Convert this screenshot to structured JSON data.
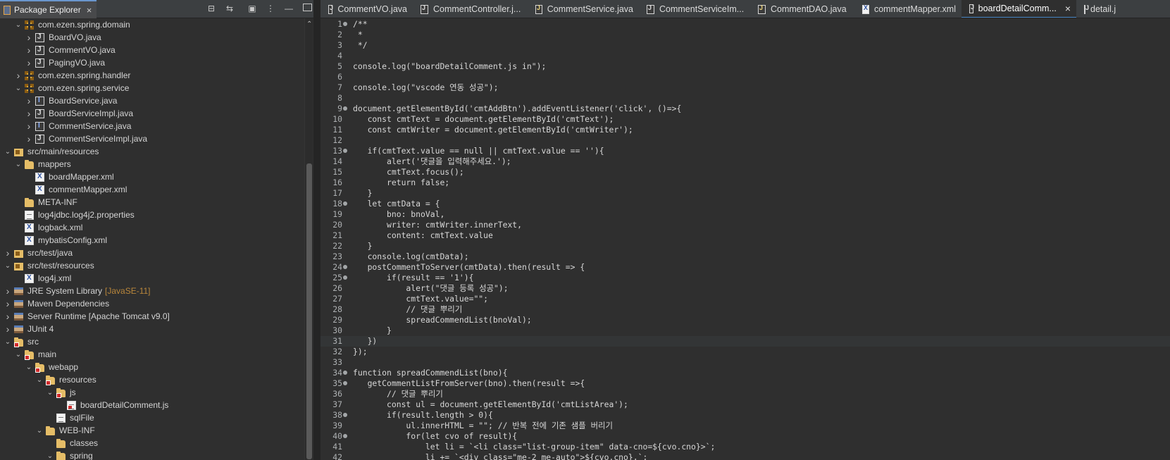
{
  "explorer": {
    "title": "Package Explorer",
    "close": "×",
    "tools": [
      "collapse-all-icon",
      "link-editor-icon",
      "focus-icon",
      "view-menu-icon",
      "minimize-icon",
      "maximize-icon"
    ],
    "rows": [
      {
        "label": "com.ezen.spring.domain",
        "depth": 2,
        "arrow": "v",
        "icon": "package"
      },
      {
        "label": "BoardVO.java",
        "depth": 3,
        "arrow": ">",
        "icon": "java"
      },
      {
        "label": "CommentVO.java",
        "depth": 3,
        "arrow": ">",
        "icon": "java"
      },
      {
        "label": "PagingVO.java",
        "depth": 3,
        "arrow": ">",
        "icon": "java"
      },
      {
        "label": "com.ezen.spring.handler",
        "depth": 2,
        "arrow": ">",
        "icon": "package"
      },
      {
        "label": "com.ezen.spring.service",
        "depth": 2,
        "arrow": "v",
        "icon": "package"
      },
      {
        "label": "BoardService.java",
        "depth": 3,
        "arrow": ">",
        "icon": "ijava"
      },
      {
        "label": "BoardServiceImpl.java",
        "depth": 3,
        "arrow": ">",
        "icon": "java"
      },
      {
        "label": "CommentService.java",
        "depth": 3,
        "arrow": ">",
        "icon": "ijava"
      },
      {
        "label": "CommentServiceImpl.java",
        "depth": 3,
        "arrow": ">",
        "icon": "java"
      },
      {
        "label": "src/main/resources",
        "depth": 1,
        "arrow": "v",
        "icon": "srcfolder"
      },
      {
        "label": "mappers",
        "depth": 2,
        "arrow": "v",
        "icon": "folder"
      },
      {
        "label": "boardMapper.xml",
        "depth": 3,
        "arrow": "",
        "icon": "xml"
      },
      {
        "label": "commentMapper.xml",
        "depth": 3,
        "arrow": "",
        "icon": "xml"
      },
      {
        "label": "META-INF",
        "depth": 2,
        "arrow": "",
        "icon": "folder"
      },
      {
        "label": "log4jdbc.log4j2.properties",
        "depth": 2,
        "arrow": "",
        "icon": "file"
      },
      {
        "label": "logback.xml",
        "depth": 2,
        "arrow": "",
        "icon": "xml"
      },
      {
        "label": "mybatisConfig.xml",
        "depth": 2,
        "arrow": "",
        "icon": "xml"
      },
      {
        "label": "src/test/java",
        "depth": 1,
        "arrow": ">",
        "icon": "srcfolder"
      },
      {
        "label": "src/test/resources",
        "depth": 1,
        "arrow": "v",
        "icon": "srcfolder"
      },
      {
        "label": "log4j.xml",
        "depth": 2,
        "arrow": "",
        "icon": "xml"
      },
      {
        "label": "JRE System Library",
        "extra": "[JavaSE-11]",
        "depth": 1,
        "arrow": ">",
        "icon": "lib"
      },
      {
        "label": "Maven Dependencies",
        "depth": 1,
        "arrow": ">",
        "icon": "lib"
      },
      {
        "label": "Server Runtime [Apache Tomcat v9.0]",
        "depth": 1,
        "arrow": ">",
        "icon": "lib"
      },
      {
        "label": "JUnit 4",
        "depth": 1,
        "arrow": ">",
        "icon": "lib"
      },
      {
        "label": "src",
        "depth": 1,
        "arrow": "v",
        "icon": "folder",
        "error": true
      },
      {
        "label": "main",
        "depth": 2,
        "arrow": "v",
        "icon": "folder",
        "error": true
      },
      {
        "label": "webapp",
        "depth": 3,
        "arrow": "v",
        "icon": "folder",
        "error": true
      },
      {
        "label": "resources",
        "depth": 4,
        "arrow": "v",
        "icon": "folder",
        "error": true
      },
      {
        "label": "js",
        "depth": 5,
        "arrow": "v",
        "icon": "folder",
        "error": true
      },
      {
        "label": "boardDetailComment.js",
        "depth": 6,
        "arrow": "",
        "icon": "file",
        "error": true
      },
      {
        "label": "sqlFile",
        "depth": 5,
        "arrow": "",
        "icon": "file"
      },
      {
        "label": "WEB-INF",
        "depth": 4,
        "arrow": "v",
        "icon": "folder"
      },
      {
        "label": "classes",
        "depth": 5,
        "arrow": "",
        "icon": "folder"
      },
      {
        "label": "spring",
        "depth": 5,
        "arrow": "v",
        "icon": "folder"
      }
    ]
  },
  "editor": {
    "tabs": [
      {
        "label": "CommentVO.java",
        "icon": "j"
      },
      {
        "label": "CommentController.j...",
        "icon": "j"
      },
      {
        "label": "CommentService.java",
        "icon": "s"
      },
      {
        "label": "CommentServiceIm...",
        "icon": "j"
      },
      {
        "label": "CommentDAO.java",
        "icon": "s"
      },
      {
        "label": "commentMapper.xml",
        "icon": "x"
      },
      {
        "label": "boardDetailComm...",
        "icon": "j",
        "active": true
      },
      {
        "label": "detail.j",
        "icon": "j"
      }
    ],
    "current_line": 31,
    "lines": [
      {
        "n": "1",
        "t": "/**",
        "fold": true
      },
      {
        "n": "2",
        "t": " *"
      },
      {
        "n": "3",
        "t": " */"
      },
      {
        "n": "4",
        "t": ""
      },
      {
        "n": "5",
        "t": "console.log(\"boardDetailComment.js in\");"
      },
      {
        "n": "6",
        "t": ""
      },
      {
        "n": "7",
        "t": "console.log(\"vscode 연동 성공\");"
      },
      {
        "n": "8",
        "t": ""
      },
      {
        "n": "9",
        "t": "document.getElementById('cmtAddBtn').addEventListener('click', ()=>{",
        "fold": true
      },
      {
        "n": "10",
        "t": "   const cmtText = document.getElementById('cmtText');"
      },
      {
        "n": "11",
        "t": "   const cmtWriter = document.getElementById('cmtWriter');"
      },
      {
        "n": "12",
        "t": ""
      },
      {
        "n": "13",
        "t": "   if(cmtText.value == null || cmtText.value == ''){",
        "fold": true
      },
      {
        "n": "14",
        "t": "       alert('댓글을 입력해주세요.');"
      },
      {
        "n": "15",
        "t": "       cmtText.focus();"
      },
      {
        "n": "16",
        "t": "       return false;"
      },
      {
        "n": "17",
        "t": "   }"
      },
      {
        "n": "18",
        "t": "   let cmtData = {",
        "fold": true
      },
      {
        "n": "19",
        "t": "       bno: bnoVal,"
      },
      {
        "n": "20",
        "t": "       writer: cmtWriter.innerText,"
      },
      {
        "n": "21",
        "t": "       content: cmtText.value"
      },
      {
        "n": "22",
        "t": "   }"
      },
      {
        "n": "23",
        "t": "   console.log(cmtData);"
      },
      {
        "n": "24",
        "t": "   postCommentToServer(cmtData).then(result => {",
        "fold": true
      },
      {
        "n": "25",
        "t": "       if(result == '1'){",
        "fold": true
      },
      {
        "n": "26",
        "t": "           alert(\"댓글 등록 성공\");"
      },
      {
        "n": "27",
        "t": "           cmtText.value=\"\";"
      },
      {
        "n": "28",
        "t": "           // 댓글 뿌리기"
      },
      {
        "n": "29",
        "t": "           spreadCommendList(bnoVal);"
      },
      {
        "n": "30",
        "t": "       }"
      },
      {
        "n": "31",
        "t": "   })"
      },
      {
        "n": "32",
        "t": "});"
      },
      {
        "n": "33",
        "t": ""
      },
      {
        "n": "34",
        "t": "function spreadCommendList(bno){",
        "fold": true
      },
      {
        "n": "35",
        "t": "   getCommentListFromServer(bno).then(result =>{",
        "fold": true
      },
      {
        "n": "36",
        "t": "       // 댓글 뿌리기"
      },
      {
        "n": "37",
        "t": "       const ul = document.getElementById('cmtListArea');"
      },
      {
        "n": "38",
        "t": "       if(result.length > 0){",
        "fold": true
      },
      {
        "n": "39",
        "t": "           ul.innerHTML = \"\"; // 반복 전에 기존 샘플 버리기"
      },
      {
        "n": "40",
        "t": "           for(let cvo of result){",
        "fold": true
      },
      {
        "n": "41",
        "t": "               let li = `<li class=\"list-group-item\" data-cno=${cvo.cno}>`;"
      },
      {
        "n": "42",
        "t": "               li += `<div class=\"me-2 me-auto\">${cvo.cno},`;"
      }
    ]
  }
}
